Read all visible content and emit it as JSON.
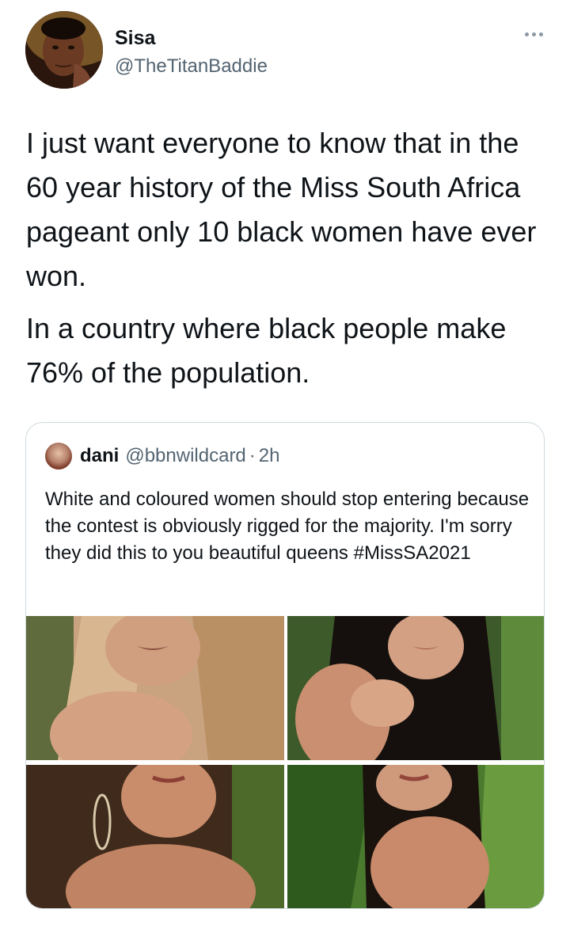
{
  "tweet": {
    "author_name": "Sisa",
    "author_handle": "@TheTitanBaddie",
    "text_p1": "I just want everyone to know that in the 60 year history of the Miss South Africa pageant only 10 black women have ever won.",
    "text_p2": "In a country where black people make 76% of the population."
  },
  "quote": {
    "author_name": "dani",
    "author_handle": "@bbnwildcard",
    "separator": "·",
    "time": "2h",
    "text": "White and coloured women should stop entering because the contest is obviously rigged for the majority. I'm sorry they did this to you beautiful queens #MissSA2021"
  },
  "icons": {
    "more": "more-options-icon"
  },
  "colors": {
    "text_primary": "#0f1419",
    "text_secondary": "#536471",
    "border": "#cfd9de"
  }
}
